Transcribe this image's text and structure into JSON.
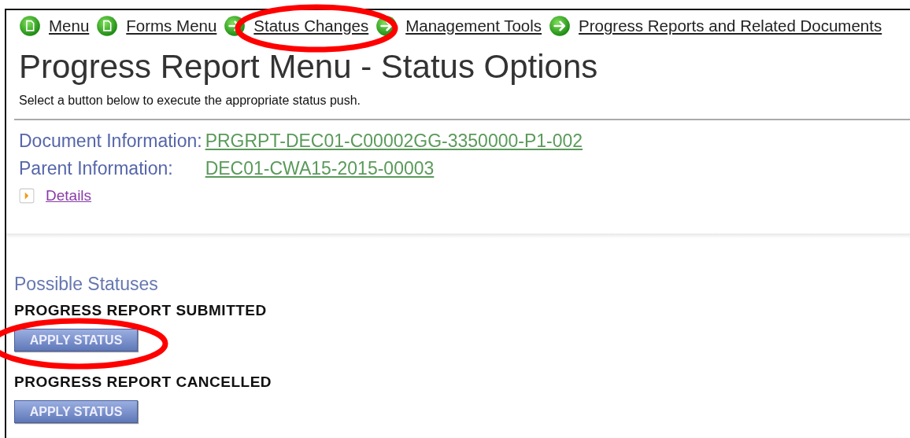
{
  "breadcrumbs": [
    {
      "label": "Menu",
      "kind": "page"
    },
    {
      "label": "Forms Menu",
      "kind": "page"
    },
    {
      "label": "Status Changes",
      "kind": "arrow"
    },
    {
      "label": "Management Tools",
      "kind": "arrow"
    },
    {
      "label": "Progress Reports and Related Documents",
      "kind": "arrow"
    }
  ],
  "title": "Progress Report Menu - Status Options",
  "subtitle": "Select a button below to execute the appropriate status push.",
  "info": [
    {
      "label": "Document Information:",
      "value": "PRGRPT-DEC01-C00002GG-3350000-P1-002"
    },
    {
      "label": "Parent Information:",
      "value": "DEC01-CWA15-2015-00003"
    }
  ],
  "details": {
    "label": "Details",
    "expanded": false
  },
  "statuses_heading": "Possible Statuses",
  "statuses": [
    {
      "name": "PROGRESS REPORT SUBMITTED",
      "button": "APPLY STATUS"
    },
    {
      "name": "PROGRESS REPORT CANCELLED",
      "button": "APPLY STATUS"
    }
  ]
}
